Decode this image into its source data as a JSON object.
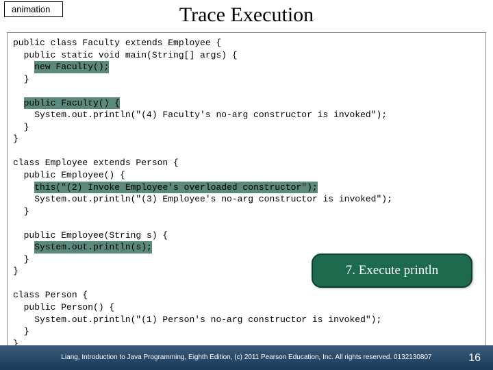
{
  "header": {
    "animation_label": "animation",
    "title": "Trace Execution"
  },
  "code": {
    "l1": "public class Faculty extends Employee {",
    "l2": "  public static void main(String[] args) {",
    "l3a": "    ",
    "l3b": "new Faculty();",
    "l4": "  }",
    "blank1": " ",
    "l5a": "  ",
    "l5b": "public Faculty() {",
    "l6": "    System.out.println(\"(4) Faculty's no-arg constructor is invoked\");",
    "l7": "  }",
    "l8": "}",
    "blank2": " ",
    "l9": "class Employee extends Person {",
    "l10": "  public Employee() {",
    "l11a": "    ",
    "l11b": "this(\"(2) Invoke Employee's overloaded constructor\");",
    "l12": "    System.out.println(\"(3) Employee's no-arg constructor is invoked\");",
    "l13": "  }",
    "blank3": " ",
    "l14": "  public Employee(String s) {",
    "l15a": "    ",
    "l15b": "System.out.println(s);",
    "l16": "  }",
    "l17": "}",
    "blank4": " ",
    "l18": "class Person {",
    "l19": "  public Person() {",
    "l20": "    System.out.println(\"(1) Person's no-arg constructor is invoked\");",
    "l21": "  }",
    "l22": "}"
  },
  "callout": {
    "text": "7. Execute println"
  },
  "footer": {
    "credit": "Liang, Introduction to Java Programming, Eighth Edition, (c) 2011 Pearson Education, Inc. All rights reserved. 0132130807",
    "page": "16"
  }
}
